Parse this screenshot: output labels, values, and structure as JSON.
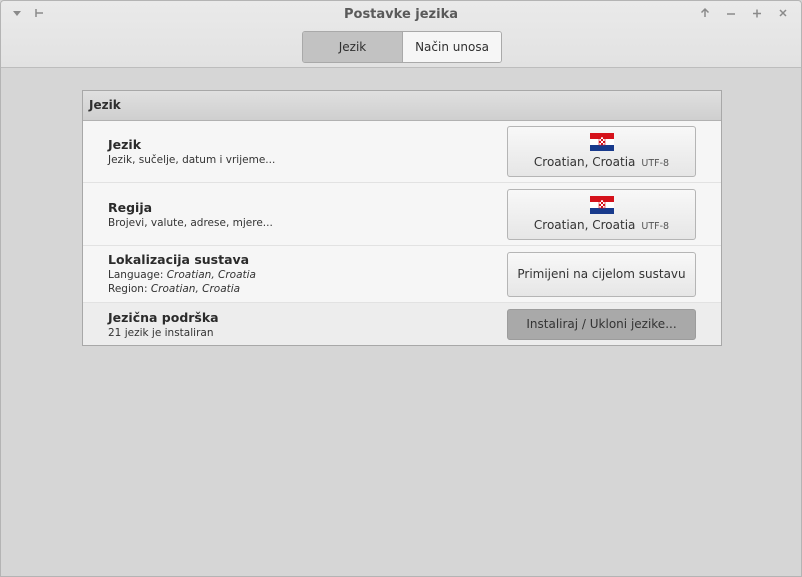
{
  "window": {
    "title": "Postavke jezika"
  },
  "titlebar_icons": {
    "left": [
      "menu-down-icon",
      "pin-icon"
    ],
    "right": [
      "keep-above-icon",
      "minimize-icon",
      "maximize-icon",
      "close-icon"
    ]
  },
  "tabs": [
    {
      "label": "Jezik",
      "active": true
    },
    {
      "label": "Način unosa",
      "active": false
    }
  ],
  "panel": {
    "header": "Jezik",
    "rows": {
      "language": {
        "title": "Jezik",
        "subtitle": "Jezik, sučelje, datum i vrijeme...",
        "button_value": "Croatian, Croatia",
        "button_encoding": "UTF-8",
        "flag_icon": "croatia-flag-icon"
      },
      "region": {
        "title": "Regija",
        "subtitle": "Brojevi, valute, adrese, mjere...",
        "button_value": "Croatian, Croatia",
        "button_encoding": "UTF-8",
        "flag_icon": "croatia-flag-icon"
      },
      "localization": {
        "title": "Lokalizacija sustava",
        "language_label": "Language:",
        "language_value": "Croatian, Croatia",
        "region_label": "Region:",
        "region_value": "Croatian, Croatia",
        "button_label": "Primijeni na cijelom sustavu"
      },
      "support": {
        "title": "Jezična podrška",
        "subtitle": "21 jezik je instaliran",
        "button_label": "Instaliraj / Ukloni jezike..."
      }
    }
  },
  "colors": {
    "flag_red": "#d5121b",
    "flag_white": "#ffffff",
    "flag_blue": "#183a8c"
  }
}
